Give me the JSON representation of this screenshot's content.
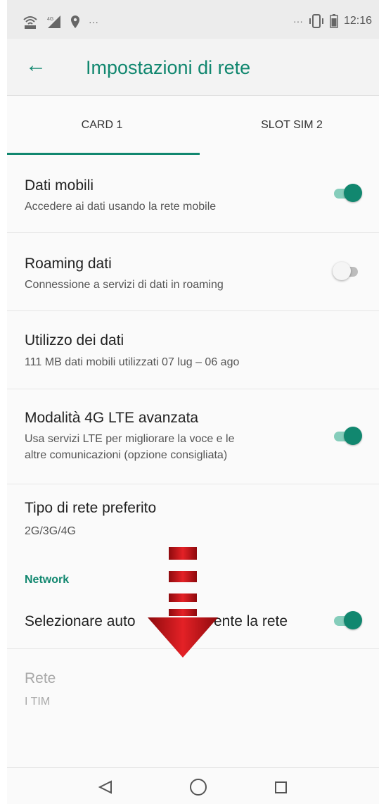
{
  "status_bar": {
    "left_icons": [
      "wifi-icon",
      "signal-4g-icon",
      "location-icon",
      "more-icon"
    ],
    "time": "12:16"
  },
  "appbar": {
    "title": "Impostazioni di rete"
  },
  "tabs": [
    {
      "label": "CARD 1",
      "selected": true
    },
    {
      "label": "SLOT SIM 2",
      "selected": false
    }
  ],
  "settings": [
    {
      "title": "Dati mobili",
      "subtitle": "Accedere ai dati usando la rete mobile",
      "toggle": true
    },
    {
      "title": "Roaming dati",
      "subtitle": "Connessione a servizi di dati in roaming",
      "toggle": false
    },
    {
      "title": "Utilizzo dei dati",
      "subtitle": "111 MB dati mobili utilizzati 07 lug – 06 ago"
    },
    {
      "title": "Modalità 4G LTE avanzata",
      "subtitle_line1": "Usa servizi LTE per migliorare la voce e le",
      "subtitle_line2": "altre comunicazioni (opzione consigliata)",
      "toggle": true
    },
    {
      "title": "Tipo di rete preferito",
      "subtitle": "2G/3G/4G"
    }
  ],
  "network": {
    "section_label": "Network",
    "auto_select": {
      "title_left": "Selezionare auto",
      "title_right": "ente la rete",
      "toggle": true
    },
    "rete": {
      "title": "Rete",
      "subtitle": "I TIM"
    }
  },
  "colors": {
    "accent": "#11876f",
    "arrow": "#d0181d"
  }
}
